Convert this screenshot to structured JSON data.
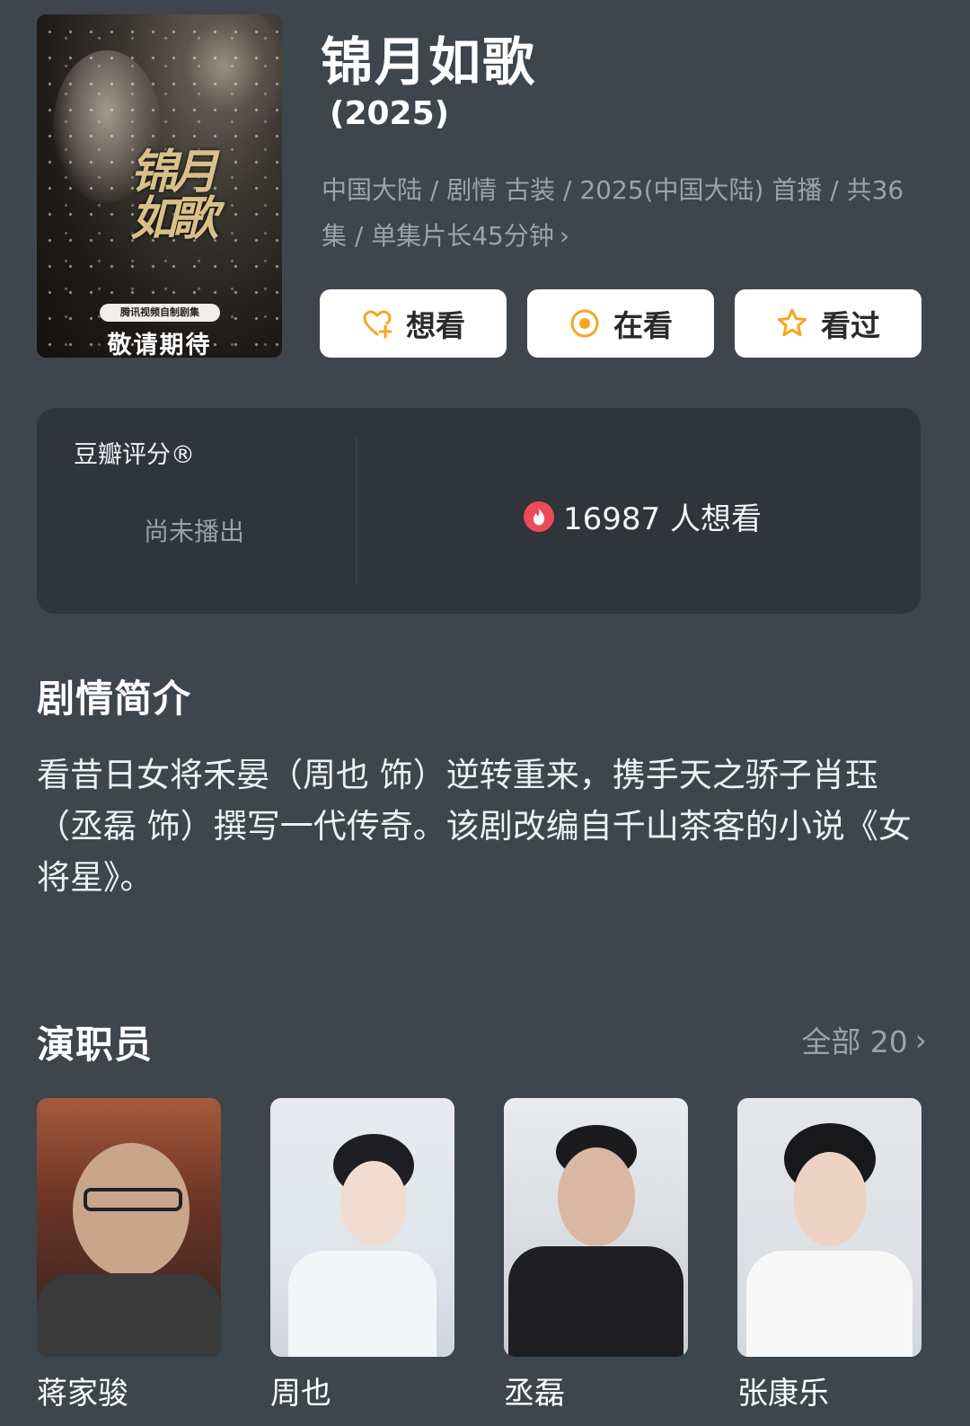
{
  "header": {
    "title": "锦月如歌",
    "year": "(2025)",
    "meta": "中国大陆 / 剧情 古装 / 2025(中国大陆) 首播 / 共36集 / 单集片长45分钟",
    "poster": {
      "badge": "腾讯视频自制剧集",
      "caption": "敬请期待",
      "calligraphy": "锦月如歌"
    }
  },
  "actions": [
    {
      "label": "想看",
      "icon": "heart-plus-icon"
    },
    {
      "label": "在看",
      "icon": "target-circle-icon"
    },
    {
      "label": "看过",
      "icon": "star-outline-icon"
    }
  ],
  "rating": {
    "label": "豆瓣评分®",
    "status": "尚未播出",
    "want_count": "16987 人想看"
  },
  "synopsis": {
    "heading": "剧情简介",
    "text": "看昔日女将禾晏（周也 饰）逆转重来，携手天之骄子肖珏（丞磊 饰）撰写一代传奇。该剧改编自千山茶客的小说《女将星》。"
  },
  "cast": {
    "heading": "演职员",
    "all_label": "全部 20",
    "members": [
      {
        "name": "蒋家骏"
      },
      {
        "name": "周也"
      },
      {
        "name": "丞磊"
      },
      {
        "name": "张康乐"
      }
    ]
  },
  "colors": {
    "background": "#3d454d",
    "card": "#2f353b",
    "accent": "#f5a623",
    "hot": "#ea4a5a"
  }
}
